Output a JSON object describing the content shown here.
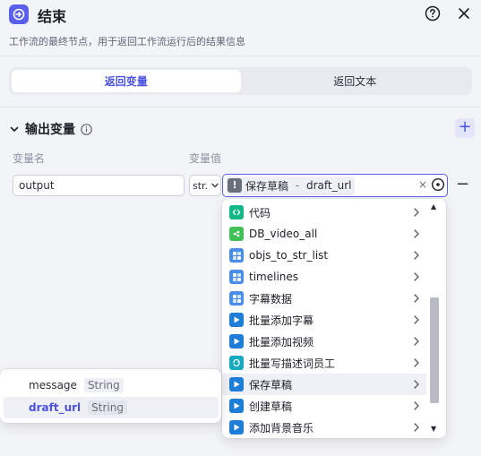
{
  "header": {
    "title": "结束",
    "subtitle": "工作流的最终节点，用于返回工作流运行后的结果信息"
  },
  "tabs": [
    {
      "label": "返回变量",
      "active": true
    },
    {
      "label": "返回文本",
      "active": false
    }
  ],
  "output": {
    "section_title": "输出变量",
    "name_col": "变量名",
    "value_col": "变量值",
    "rows": [
      {
        "name": "output",
        "type": "str.",
        "value_prefix": "保存草稿",
        "value_sep": " - ",
        "value_var": "draft_url"
      }
    ],
    "add_label": "+",
    "remove_label": "−"
  },
  "dropdown": {
    "items": [
      {
        "label": "代码",
        "icon": "code-icon",
        "color": "#12b886"
      },
      {
        "label": "DB_video_all",
        "icon": "database-icon",
        "color": "#40c057"
      },
      {
        "label": "objs_to_str_list",
        "icon": "plugin-icon",
        "color": "#4a8fe7"
      },
      {
        "label": "timelines",
        "icon": "plugin-icon",
        "color": "#4a8fe7"
      },
      {
        "label": "字幕数据",
        "icon": "plugin-icon",
        "color": "#4a8fe7"
      },
      {
        "label": "批量添加字幕",
        "icon": "video-plugin-icon",
        "color": "#1c7ed6"
      },
      {
        "label": "批量添加视频",
        "icon": "video-plugin-icon",
        "color": "#1c7ed6"
      },
      {
        "label": "批量写描述词员工",
        "icon": "loop-icon",
        "color": "#15aabf"
      },
      {
        "label": "保存草稿",
        "icon": "video-plugin-icon",
        "color": "#1c7ed6"
      },
      {
        "label": "创建草稿",
        "icon": "video-plugin-icon",
        "color": "#1c7ed6"
      },
      {
        "label": "添加背景音乐",
        "icon": "video-plugin-icon",
        "color": "#1c7ed6"
      }
    ],
    "hover_index": 8
  },
  "variables_popup": {
    "items": [
      {
        "name": "message",
        "type": "String",
        "selected": false
      },
      {
        "name": "draft_url",
        "type": "String",
        "selected": true
      }
    ]
  },
  "colors": {
    "accent": "#4c53e3",
    "background": "#f3f4f7"
  }
}
